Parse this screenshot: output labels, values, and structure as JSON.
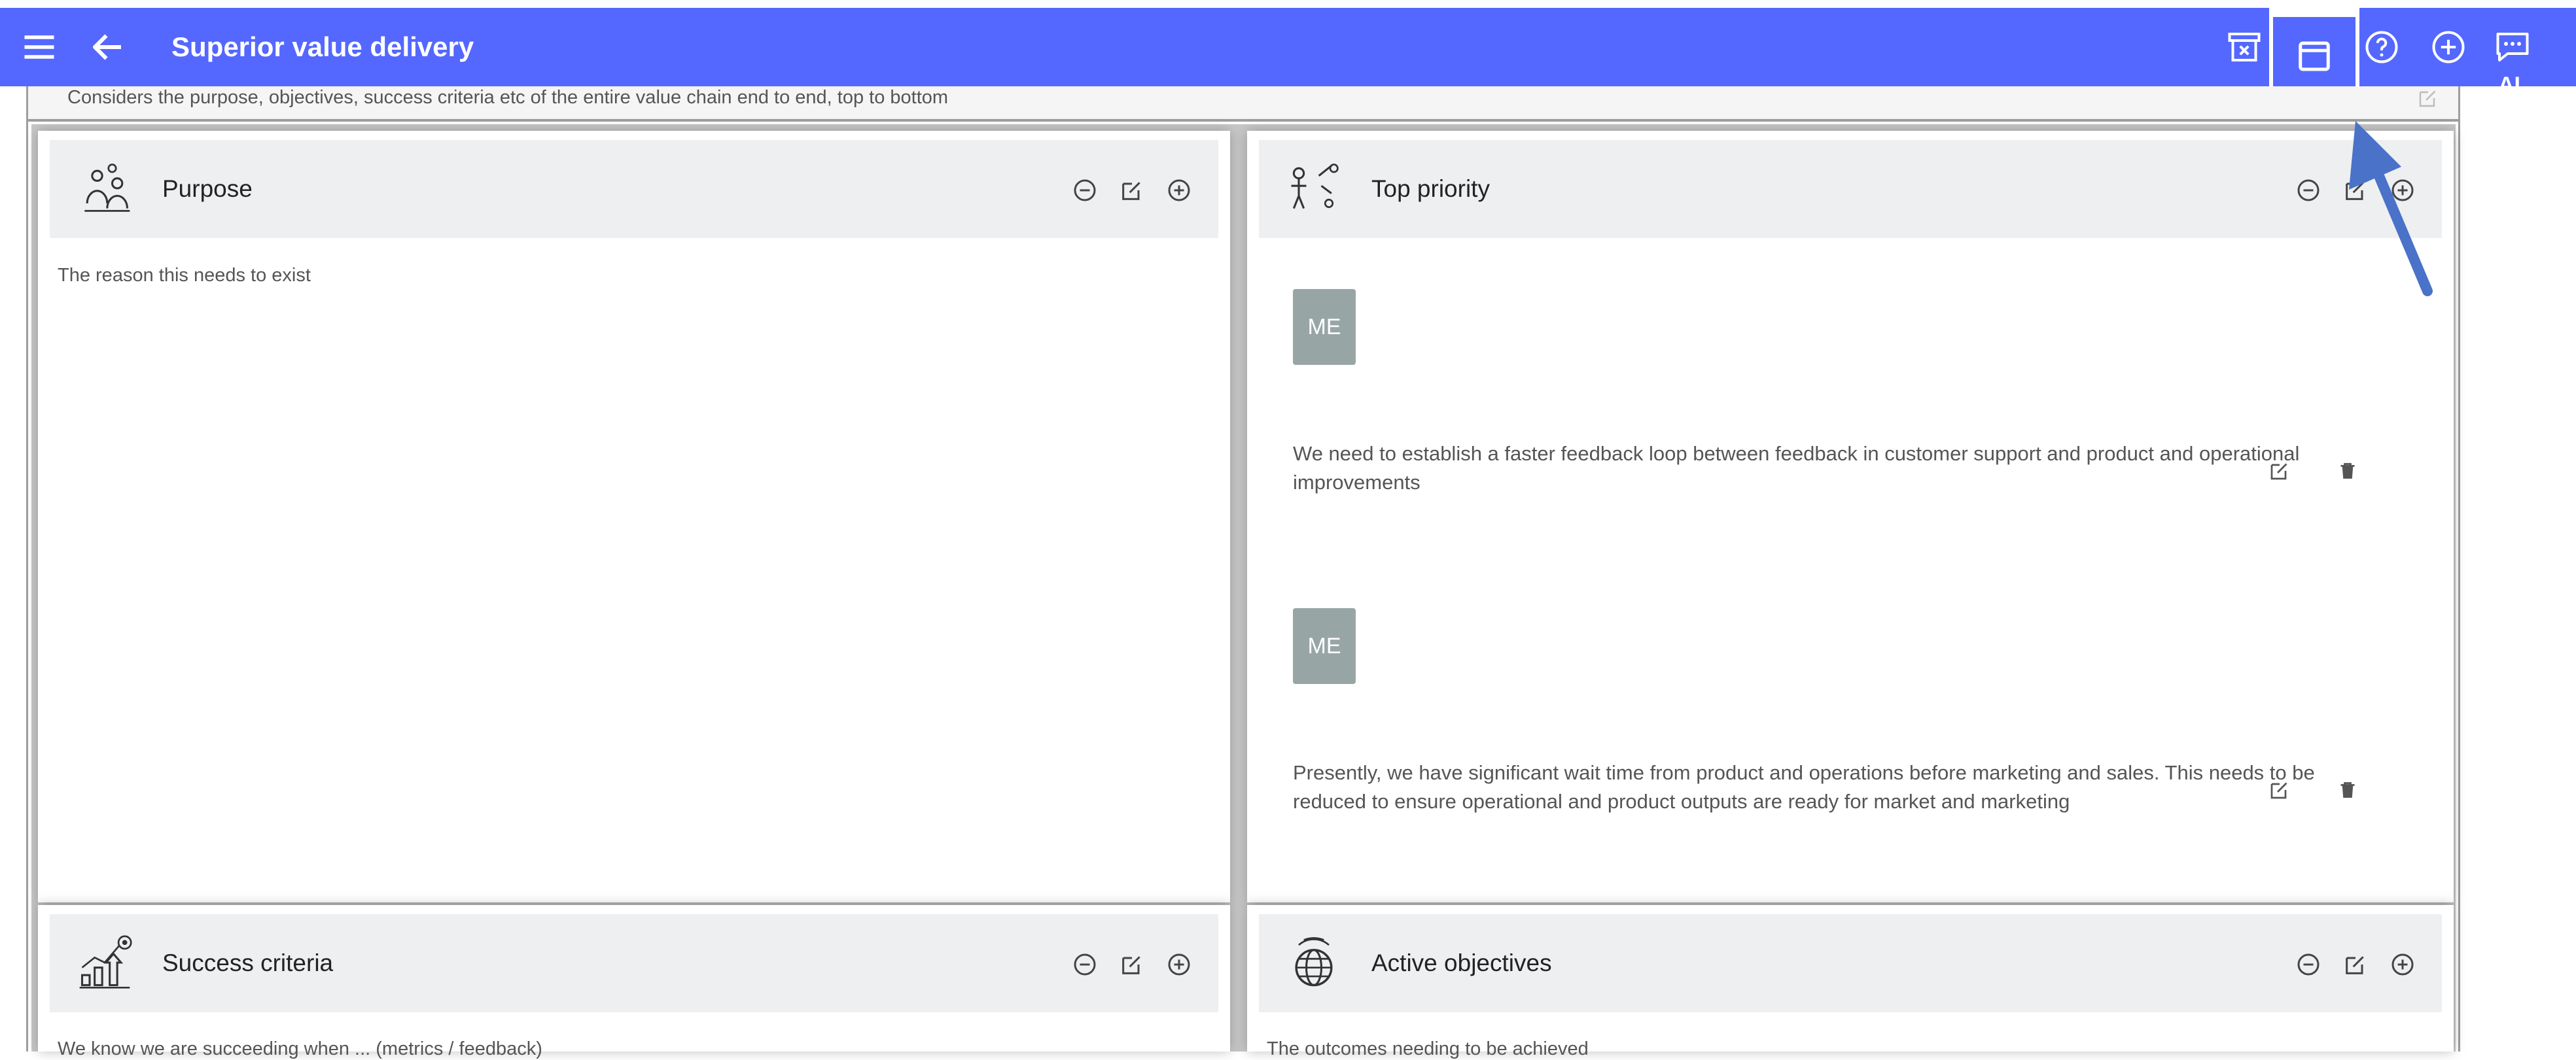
{
  "app": {
    "title": "Superior value delivery",
    "ai_label": "AI",
    "icons": [
      "menu-icon",
      "back-arrow-icon",
      "archive-icon",
      "window-icon",
      "help-icon",
      "add-circle-icon",
      "chat-ai-icon"
    ],
    "colors": {
      "appbar": "#5468ff",
      "avatar": "#98a5a5",
      "arrow": "#4a72c8"
    }
  },
  "header_desc": "Considers the purpose, objectives, success criteria etc of the entire value chain end to end, top to bottom",
  "panels": {
    "purpose": {
      "title": "Purpose",
      "desc": "The reason this needs to exist"
    },
    "top_priority": {
      "title": "Top priority",
      "entries": [
        {
          "avatar": "ME",
          "text": "We need to establish a faster feedback loop between feedback in customer support and product and operational improvements"
        },
        {
          "avatar": "ME",
          "text": "Presently, we have significant wait time from product and operations before marketing and sales. This needs to be reduced to ensure operational and product outputs are ready for market and marketing"
        }
      ]
    },
    "success_criteria": {
      "title": "Success criteria",
      "desc": "We know we are succeeding when ... (metrics / feedback)"
    },
    "active_objectives": {
      "title": "Active objectives",
      "desc": "The outcomes needing to be achieved"
    }
  }
}
